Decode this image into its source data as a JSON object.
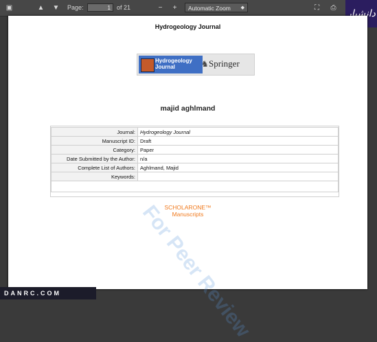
{
  "toolbar": {
    "page_label": "Page:",
    "page_value": "1",
    "page_total": "of 21",
    "zoom_out": "−",
    "zoom_in": "+",
    "zoom_value": "Automatic Zoom"
  },
  "brand_badge": "دانشیار",
  "document": {
    "journal_title": "Hydrogeology Journal",
    "banner_journal": "Hydrogeology Journal",
    "banner_publisher": "Springer",
    "author_name": "majid aghlmand",
    "fields": [
      {
        "label": "Journal:",
        "value": "Hydrogeology Journal"
      },
      {
        "label": "Manuscript ID:",
        "value": "Draft"
      },
      {
        "label": "Category:",
        "value": "Paper"
      },
      {
        "label": "Date Submitted by the Author:",
        "value": "n/a"
      },
      {
        "label": "Complete List of Authors:",
        "value": "Aghlmand, Majid"
      },
      {
        "label": "Keywords:",
        "value": ""
      }
    ],
    "scholarone_brand": "SCHOLARONE™",
    "scholarone_sub": "Manuscripts",
    "watermark": "For Peer Review"
  },
  "footer_logo": "DANRC.COM"
}
